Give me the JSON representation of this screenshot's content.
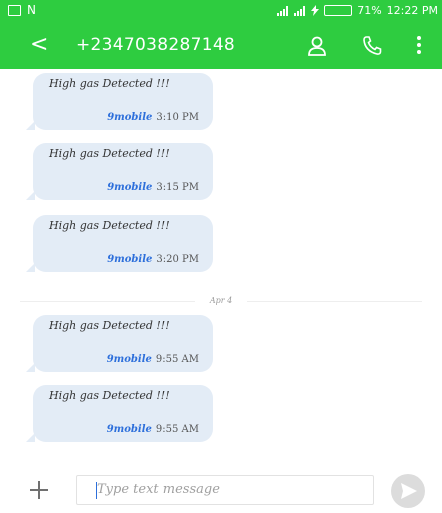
{
  "status_bar": {
    "left_text": "N",
    "battery_percent": "71%",
    "time": "12:22 PM",
    "icons": [
      "message-notification-icon",
      "signal-icon",
      "signal-icon",
      "charging-icon",
      "battery-icon"
    ]
  },
  "app_bar": {
    "contact_number": "+2347038287148",
    "icons": [
      "back-arrow-icon",
      "person-icon",
      "phone-icon",
      "more-vert-icon"
    ],
    "color": "#2ecc40"
  },
  "thread": {
    "messages_before": [
      {
        "text": "High gas Detected !!!",
        "sim": "9mobile",
        "time": "3:10 PM"
      },
      {
        "text": "High gas Detected !!!",
        "sim": "9mobile",
        "time": "3:15 PM"
      },
      {
        "text": "High gas Detected !!!",
        "sim": "9mobile",
        "time": "3:20 PM"
      }
    ],
    "date_divider": "Apr 4",
    "messages_after": [
      {
        "text": "High gas Detected !!!",
        "sim": "9mobile",
        "time": "9:55 AM"
      },
      {
        "text": "High gas Detected !!!",
        "sim": "9mobile",
        "time": "9:55 AM"
      }
    ],
    "bubble_color": "#e3ecf6",
    "sim_color": "#2d6fdb"
  },
  "compose": {
    "placeholder": "Type text message",
    "icons": [
      "add-icon",
      "send-icon"
    ]
  }
}
